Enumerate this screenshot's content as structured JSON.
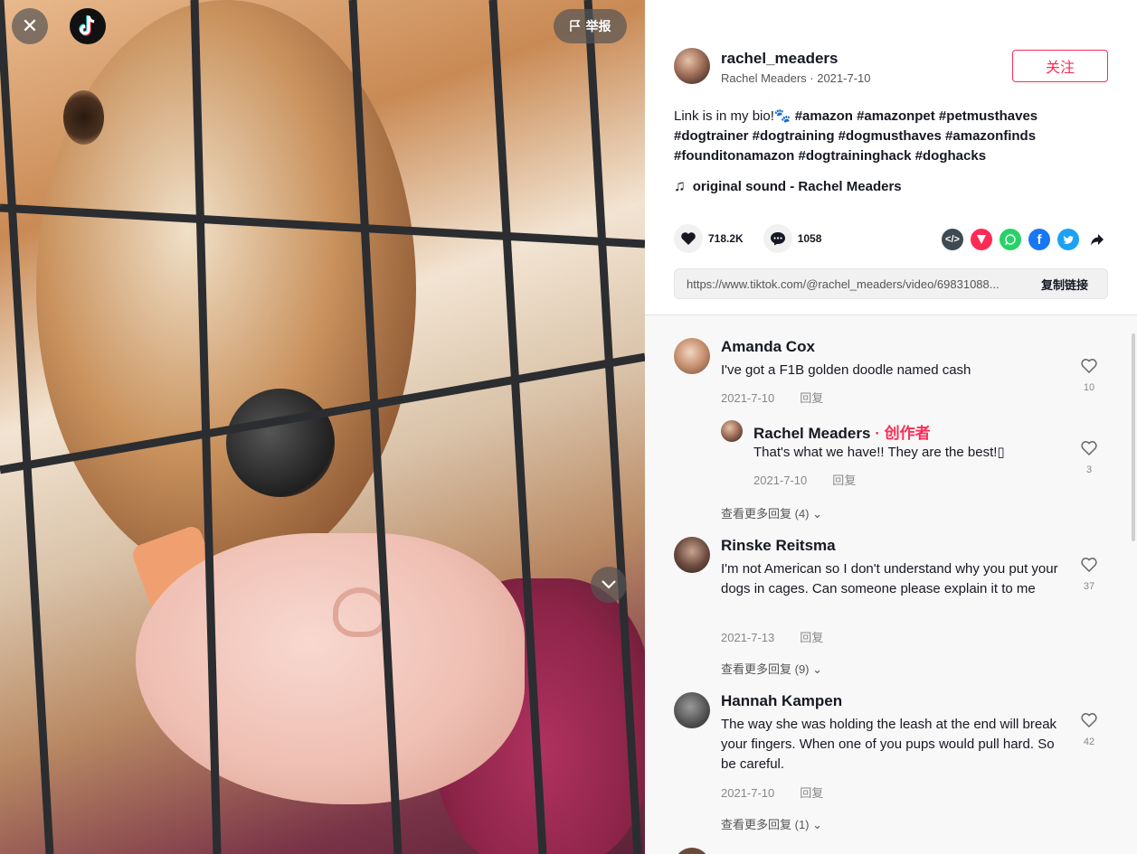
{
  "video": {
    "report_label": "举报"
  },
  "author": {
    "username": "rachel_meaders",
    "subtitle": "Rachel Meaders · 2021-7-10",
    "follow_label": "关注"
  },
  "description": {
    "text": "Link is in my bio!🐾 ",
    "hashtags_line1": "#amazon #amazonpet #petmusthaves",
    "hashtags_line2": "#dogtrainer #dogtraining #dogmusthaves #amazonfinds",
    "hashtags_line3": "#founditonamazon #dogtraininghack #doghacks"
  },
  "music": {
    "label": "original sound - Rachel Meaders",
    "icon": "music-note-icon"
  },
  "stats": {
    "likes": "718.2K",
    "comments": "1058"
  },
  "share": {
    "icons": [
      "embed-icon",
      "send-icon",
      "whatsapp-icon",
      "facebook-icon",
      "twitter-icon",
      "share-arrow-icon"
    ],
    "colors": {
      "embed": "#3f4a53",
      "send": "#fe2c55",
      "whatsapp": "#25d366",
      "facebook": "#1877f2",
      "twitter": "#1da1f2"
    }
  },
  "link": {
    "url": "https://www.tiktok.com/@rachel_meaders/video/69831088...",
    "copy_label": "复制链接"
  },
  "comments": [
    {
      "name": "Amanda Cox",
      "text": "I've got a F1B golden doodle named cash",
      "date": "2021-7-10",
      "reply_label": "回复",
      "likes": "10"
    },
    {
      "name": "Rachel Meaders",
      "creator_label": "· 创作者",
      "text": "That's what we have!! They are the best!▯",
      "date": "2021-7-10",
      "reply_label": "回复",
      "likes": "3"
    },
    {
      "more_label": "查看更多回复 (4)"
    },
    {
      "name": "Rinske Reitsma",
      "text": "I'm not American so I don't understand why you put your dogs in cages. Can someone please explain it to me",
      "date": "2021-7-13",
      "reply_label": "回复",
      "likes": "37",
      "more_label": "查看更多回复 (9)"
    },
    {
      "name": "Hannah Kampen",
      "text": "The way she was holding the leash at the end will break your fingers. When one of you pups would pull hard. So be careful.",
      "date": "2021-7-10",
      "reply_label": "回复",
      "likes": "42",
      "more_label": "查看更多回复 (1)"
    }
  ]
}
